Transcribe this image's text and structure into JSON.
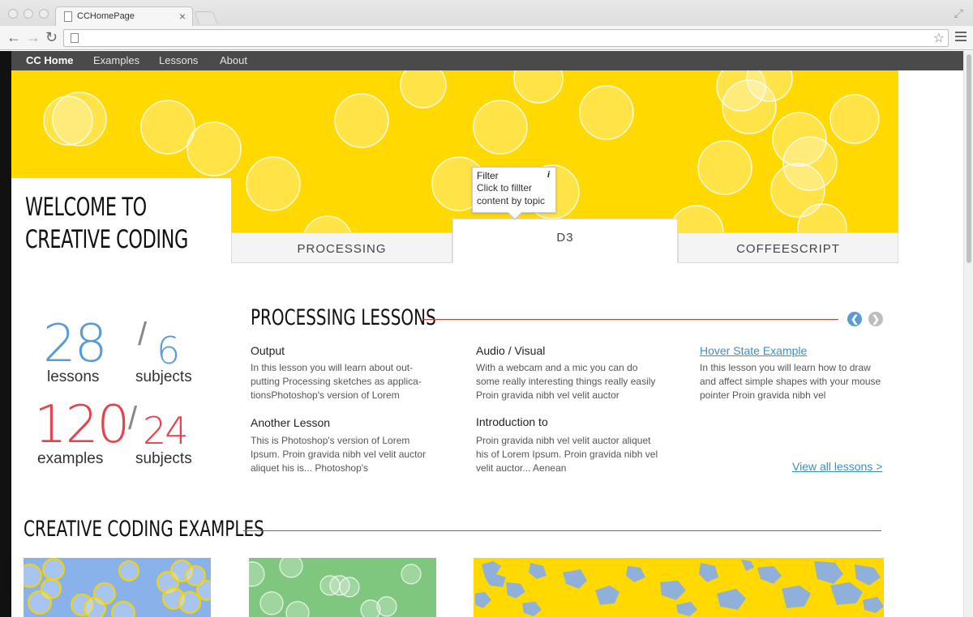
{
  "browser": {
    "tab_title": "CCHomePage",
    "tab_close": "×",
    "back_icon": "←",
    "forward_icon": "→",
    "reload_icon": "↻",
    "star_icon": "☆"
  },
  "site_nav": {
    "items": [
      "CC Home",
      "Examples",
      "Lessons",
      "About"
    ]
  },
  "welcome": {
    "line1": "WELCOME TO",
    "line2": "CREATIVE CODING"
  },
  "topic_tabs": [
    "PROCESSING",
    "D3",
    "COFFEESCRIPT"
  ],
  "tooltip": {
    "title": "Filter",
    "icon": "i",
    "line1": "Click to fillter",
    "line2": "content by topic"
  },
  "stats": {
    "lessons_count": "28",
    "lessons_label": "lessons",
    "lesson_subjects_count": "6",
    "lesson_subjects_label": "subjects",
    "examples_count": "120",
    "examples_label": "examples",
    "example_subjects_count": "24",
    "example_subjects_label": "subjects",
    "slash": "/",
    "colors": {
      "blue": "#5b9bd5",
      "red": "#e8414b"
    }
  },
  "lessons_section": {
    "title": "PROCESSING LESSONS",
    "prev_icon": "❮",
    "next_icon": "❯",
    "view_all": "View all lessons >",
    "lessons": [
      {
        "title": "Output",
        "body": "In this lesson you will learn about out-putting Processing sketches as applica-tionsPhotoshop's version  of Lorem"
      },
      {
        "title": "Audio / Visual",
        "body": "With a webcam and a mic you can do some really interesting things really easily Proin gravida nibh vel velit auctor"
      },
      {
        "title": "Hover State Example",
        "body": "In this lesson you will learn how to draw and affect simple shapes with your mouse pointer Proin gravida nibh vel"
      },
      {
        "title": "Another Lesson",
        "body": "This is Photoshop's version  of Lorem Ipsum. Proin gravida nibh vel velit auctor aliquet his is... Photoshop's"
      },
      {
        "title": "Introduction to",
        "body": "Proin gravida nibh vel velit auctor aliquet his of Lorem Ipsum. Proin gravida nibh vel velit auctor... Aenean"
      }
    ]
  },
  "examples_section": {
    "title": "CREATIVE CODING EXAMPLES"
  },
  "colors": {
    "hero_yellow": "#ffd900",
    "accent_red": "#d33b3b",
    "link_blue": "#3a8fc4",
    "nav_gray": "#4a4a4a"
  }
}
